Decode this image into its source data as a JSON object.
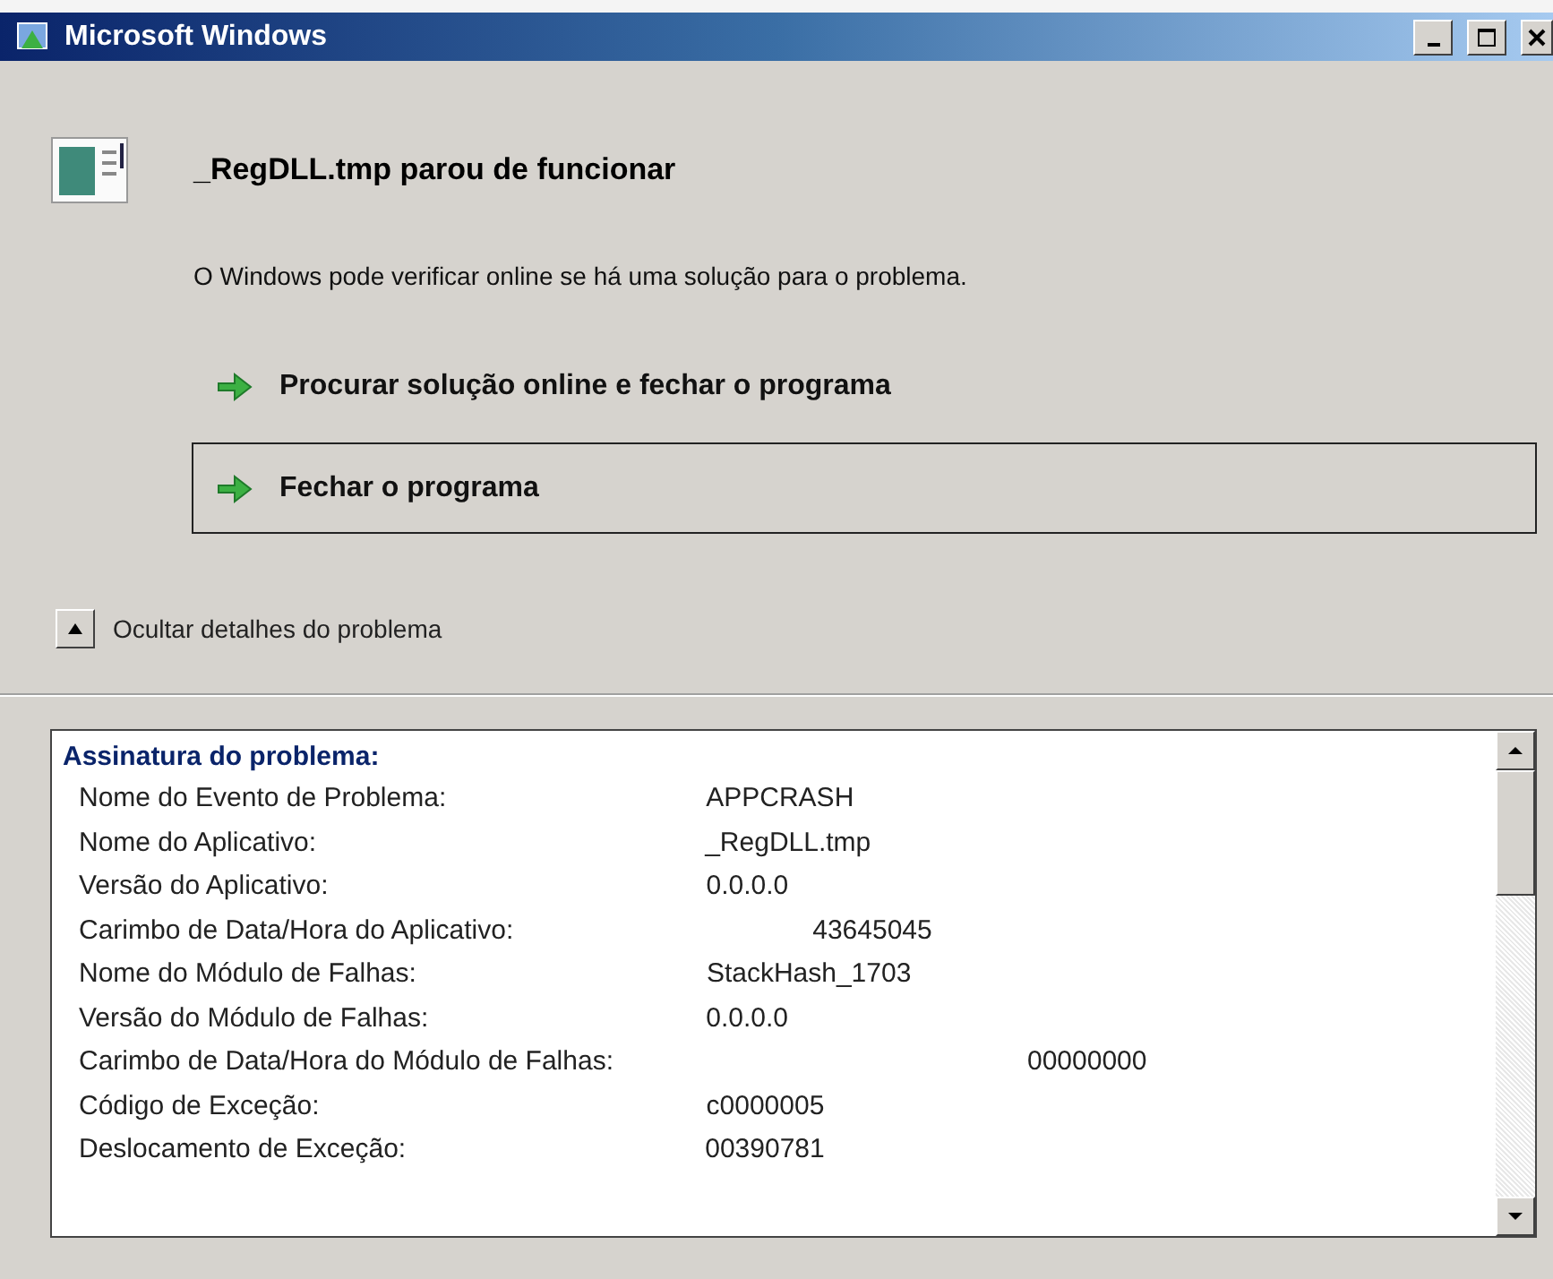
{
  "window": {
    "title": "Microsoft Windows"
  },
  "header": {
    "title": "_RegDLL.tmp parou de funcionar",
    "description": "O Windows pode verificar online se há uma solução para o problema."
  },
  "actions": [
    {
      "label": "Procurar solução online e fechar o programa",
      "focused": false
    },
    {
      "label": "Fechar o programa",
      "focused": true
    }
  ],
  "details_toggle": {
    "label": "Ocultar detalhes do problema",
    "expanded": true
  },
  "details": {
    "heading": "Assinatura do problema:",
    "rows": [
      {
        "label": "Nome do Evento de Problema:",
        "value": "APPCRASH"
      },
      {
        "label": "Nome do Aplicativo:",
        "value": "_RegDLL.tmp"
      },
      {
        "label": "Versão do Aplicativo:",
        "value": "0.0.0.0"
      },
      {
        "label": "Carimbo de Data/Hora do Aplicativo:",
        "value": "43645045"
      },
      {
        "label": "Nome do Módulo de Falhas:",
        "value": "StackHash_1703"
      },
      {
        "label": "Versão do Módulo de Falhas:",
        "value": "0.0.0.0"
      },
      {
        "label": "Carimbo de Data/Hora do Módulo de Falhas:",
        "value": "00000000"
      },
      {
        "label": "Código de Exceção:",
        "value": "c0000005"
      },
      {
        "label": "Deslocamento de Exceção:",
        "value": "00390781"
      }
    ]
  }
}
